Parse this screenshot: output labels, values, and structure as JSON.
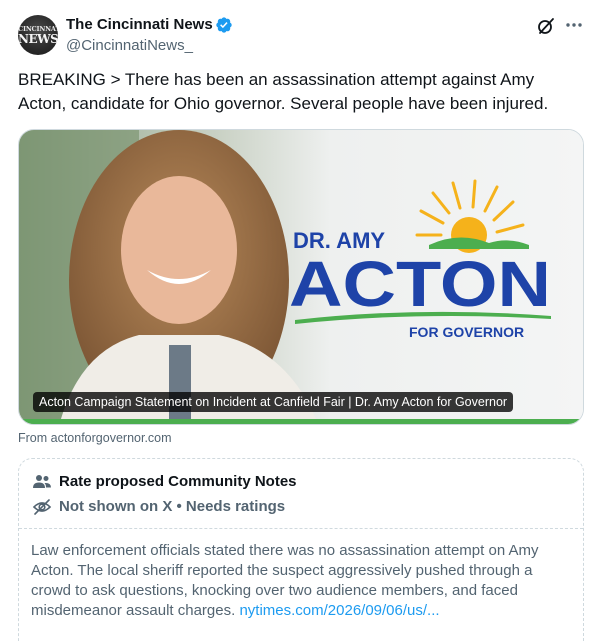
{
  "author": {
    "avatar_line1": "CINCINNATI",
    "avatar_line2": "NEWS",
    "name": "The Cincinnati News",
    "handle": "@CincinnatiNews_",
    "verified_color": "#1d9bf0"
  },
  "post": {
    "text_line1": "BREAKING > There has been an assassination attempt against Amy",
    "text_line2": "Acton, candidate for Ohio governor. Several people have been injured."
  },
  "media": {
    "logo_line1": "DR. AMY",
    "logo_line2": "ACTON",
    "logo_line3": "FOR GOVERNOR",
    "caption": "Acton Campaign Statement on Incident at Canfield Fair | Dr. Amy Acton for Governor",
    "source": "From actonforgovernor.com",
    "brand_blue": "#1e43a8",
    "brand_green": "#4cae4f",
    "sun_yellow": "#f5b21b"
  },
  "community_notes": {
    "title": "Rate proposed Community Notes",
    "status": "Not shown on X • Needs ratings",
    "body_line1": "Law enforcement officials stated there was no assassination attempt on Amy",
    "body_line2": "Acton. The local sheriff reported the suspect aggressively pushed through a",
    "body_line3": "crowd to ask questions, knocking over two audience members, and faced",
    "body_line4_text": "misdemeanor assault charges.",
    "body_link": "nytimes.com/2026/09/06/us/..."
  },
  "icons": {
    "grok": "grok-icon",
    "more": "more-icon",
    "people": "people-icon",
    "hidden": "eye-slash-icon",
    "verified": "verified-badge-icon"
  }
}
